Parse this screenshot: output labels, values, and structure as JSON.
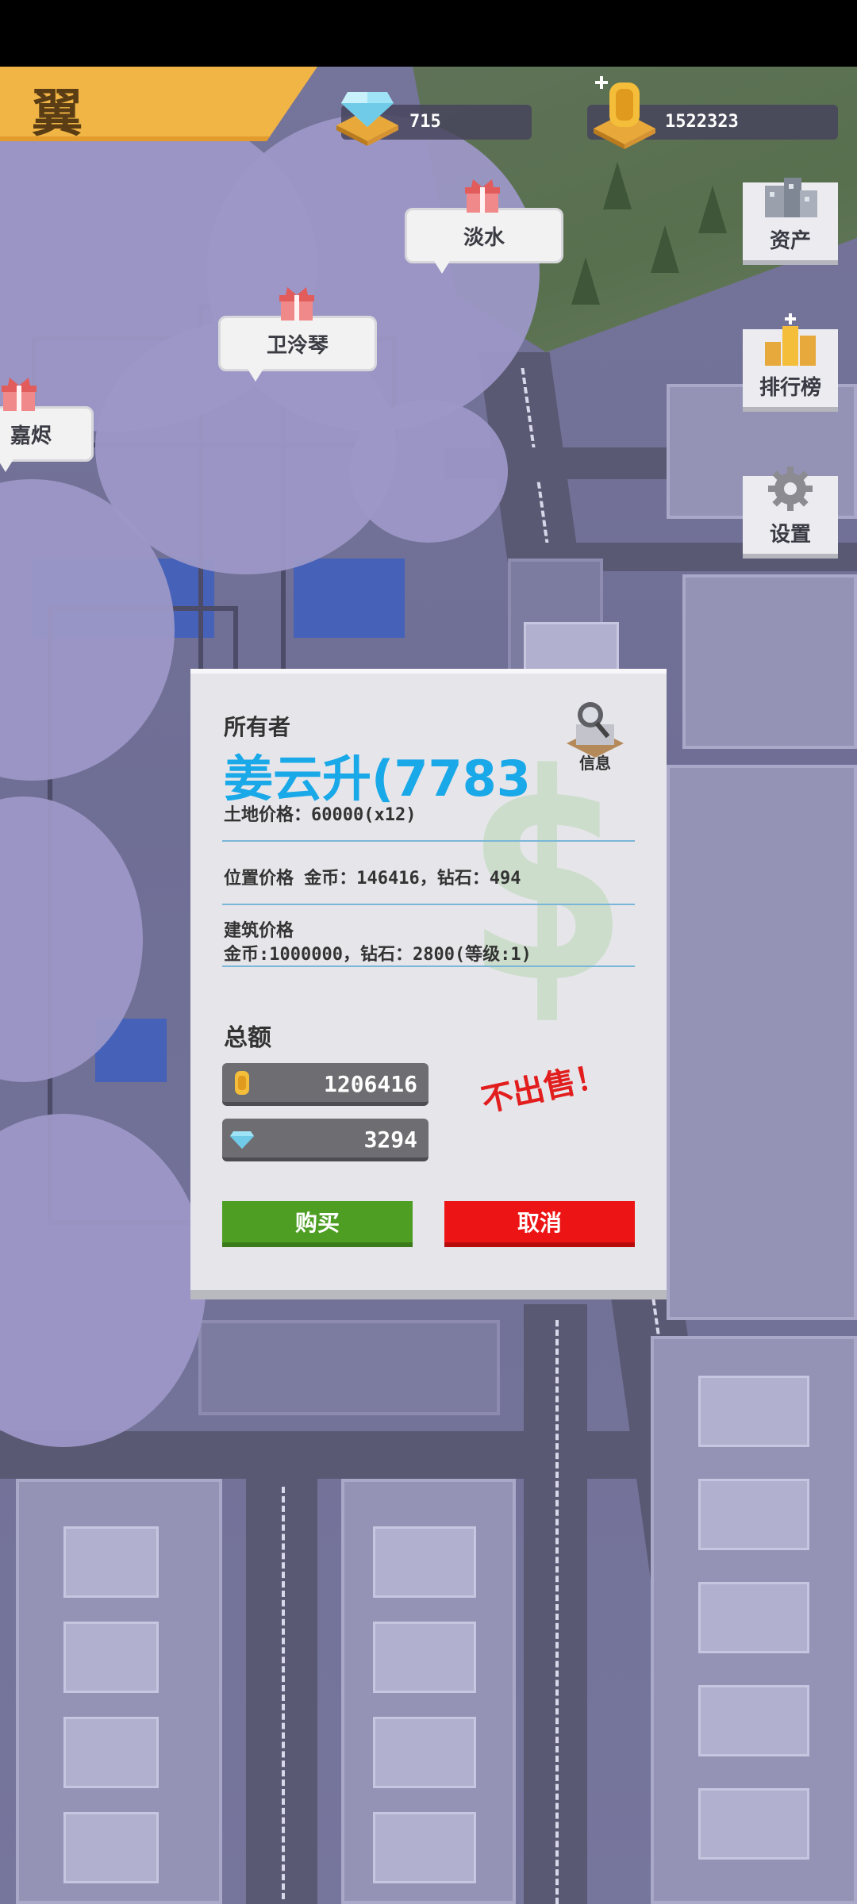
{
  "hud": {
    "banner_char": "翼",
    "diamonds": "715",
    "coins": "1522323",
    "diamond_icon": "diamond-icon",
    "coin_icon": "coin-icon"
  },
  "side_menu": {
    "assets": "资产",
    "ranking": "排行榜",
    "settings": "设置"
  },
  "map_tags": [
    {
      "label": "淡水"
    },
    {
      "label": "卫泠琴"
    },
    {
      "label": "嘉烬"
    }
  ],
  "dialog": {
    "owner_label": "所有者",
    "owner_name": "姜云升(7783",
    "info_label": "信息",
    "land_price": "土地价格：60000(x12)",
    "location_price": "位置价格 金币：146416，钻石：494",
    "building_price_title": "建筑价格",
    "building_price": "金币:1000000，钻石：2800(等级:1)",
    "total_label": "总额",
    "total_coins": "1206416",
    "total_diamonds": "3294",
    "not_for_sale": "不出售！",
    "buy": "购买",
    "cancel": "取消"
  },
  "colors": {
    "banner": "#f0b545",
    "owner_name": "#19a8e8",
    "buy": "#4e9e24",
    "cancel": "#ec1414",
    "not_for_sale": "#e21d1d"
  }
}
